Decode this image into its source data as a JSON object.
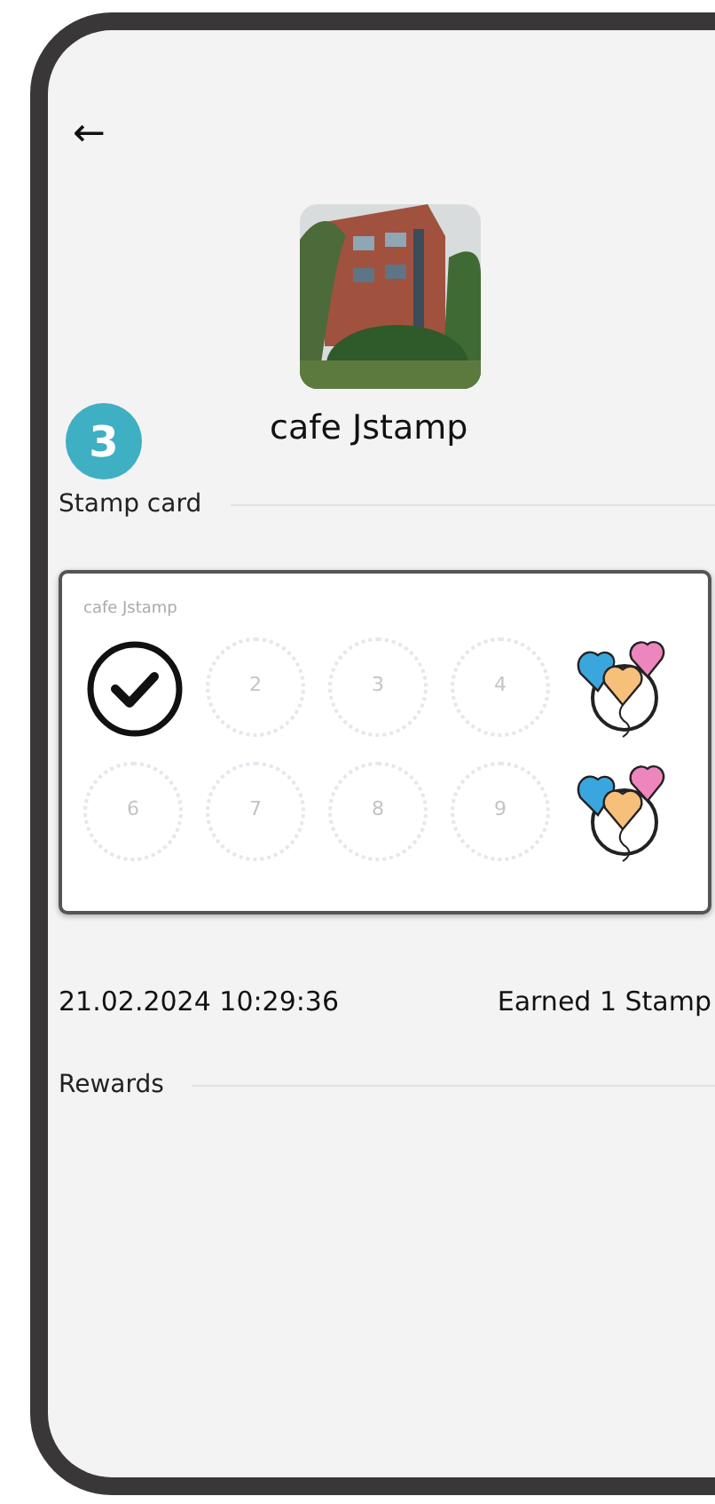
{
  "header": {
    "back": "←"
  },
  "store": {
    "kind": "picture",
    "name": "cafe Jstamp"
  },
  "step_badge": "3",
  "stamp_section": {
    "title": "Stamp card"
  },
  "card": {
    "title": "cafe Jstamp",
    "slots": [
      {
        "kind": "stamped"
      },
      {
        "kind": "empty",
        "number": "2"
      },
      {
        "kind": "empty",
        "number": "3"
      },
      {
        "kind": "empty",
        "number": "4"
      },
      {
        "kind": "reward"
      },
      {
        "kind": "empty",
        "number": "6"
      },
      {
        "kind": "empty",
        "number": "7"
      },
      {
        "kind": "empty",
        "number": "8"
      },
      {
        "kind": "empty",
        "number": "9"
      },
      {
        "kind": "reward"
      }
    ]
  },
  "history": [
    {
      "time": "21.02.2024 10:29:36",
      "event": "Earned 1 Stamp"
    }
  ],
  "rewards_section": {
    "title": "Rewards"
  }
}
